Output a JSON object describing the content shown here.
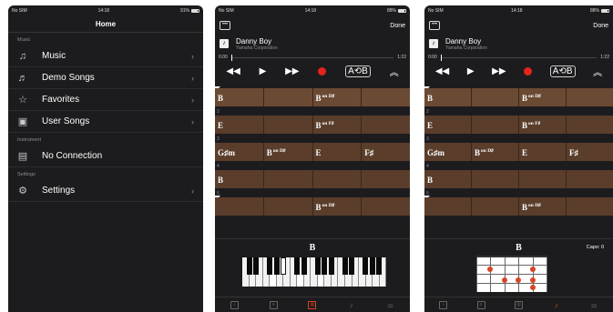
{
  "statusbar": {
    "carrier": "No SIM",
    "wifi": "wifi-icon",
    "time": "14:18",
    "battery_p1": "91%",
    "battery_p2": "88%",
    "battery_p3": "88%"
  },
  "home": {
    "title": "Home",
    "sections": {
      "music_label": "Music",
      "instrument_label": "Instrument",
      "settings_label": "Settings"
    },
    "items": {
      "music": "Music",
      "demo": "Demo Songs",
      "favorites": "Favorites",
      "user": "User Songs",
      "connection": "No Connection",
      "settings": "Settings"
    }
  },
  "player": {
    "menu_icon": "ellipsis-icon",
    "done_label": "Done",
    "song_title": "Danny Boy",
    "song_artist": "Yamaha Corporation",
    "art_glyph": "♪",
    "time_start": "0:00",
    "time_end": "1:22",
    "ab_label": "A⟲B",
    "current_chord": "B",
    "capo_label": "Capo: 0"
  },
  "chords": {
    "rows": [
      {
        "num": "",
        "cells": [
          {
            "c": "B",
            "s": ""
          },
          {
            "c": "",
            "s": ""
          },
          {
            "c": "B",
            "s": "on D♯"
          },
          {
            "c": "",
            "s": ""
          }
        ]
      },
      {
        "num": "2",
        "cells": [
          {
            "c": "E",
            "s": ""
          },
          {
            "c": "",
            "s": ""
          },
          {
            "c": "B",
            "s": "on F♯"
          },
          {
            "c": "",
            "s": ""
          }
        ]
      },
      {
        "num": "3",
        "cells": [
          {
            "c": "G♯m",
            "s": ""
          },
          {
            "c": "B",
            "s": "on D♯"
          },
          {
            "c": "E",
            "s": ""
          },
          {
            "c": "F♯",
            "s": ""
          }
        ]
      },
      {
        "num": "4",
        "cells": [
          {
            "c": "B",
            "s": ""
          },
          {
            "c": "",
            "s": ""
          },
          {
            "c": "",
            "s": ""
          },
          {
            "c": "",
            "s": ""
          }
        ]
      },
      {
        "num": "5",
        "cells": [
          {
            "c": "",
            "s": ""
          },
          {
            "c": "",
            "s": ""
          },
          {
            "c": "B",
            "s": "on D♯"
          },
          {
            "c": "",
            "s": ""
          }
        ]
      }
    ]
  },
  "colors": {
    "record": "#e5231d",
    "lane": "#5a3d2b",
    "accent": "#d64528"
  }
}
